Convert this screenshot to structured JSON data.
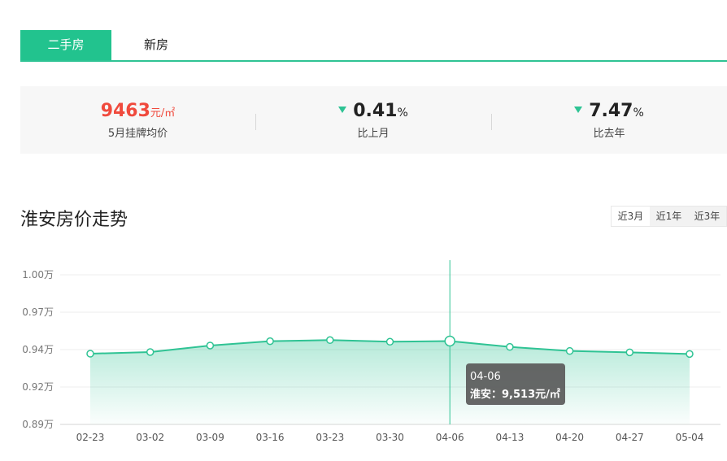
{
  "tabs": [
    {
      "label": "二手房",
      "active": true
    },
    {
      "label": "新房",
      "active": false
    }
  ],
  "stats": {
    "price": {
      "value": "9463",
      "unit": "元/㎡",
      "label": "5月挂牌均价"
    },
    "mom": {
      "value": "0.41",
      "unit": "%",
      "label": "比上月",
      "direction": "down"
    },
    "yoy": {
      "value": "7.47",
      "unit": "%",
      "label": "比去年",
      "direction": "down"
    }
  },
  "section_title": "淮安房价走势",
  "range_buttons": [
    {
      "label": "近3月",
      "active": true
    },
    {
      "label": "近1年",
      "active": false
    },
    {
      "label": "近3年",
      "active": false
    }
  ],
  "tooltip": {
    "date": "04-06",
    "text": "淮安：9,513元/㎡"
  },
  "colors": {
    "accent": "#22c38e",
    "line": "#2fc394",
    "price": "#f04a3d"
  },
  "chart_data": {
    "type": "area",
    "categories": [
      "02-23",
      "03-02",
      "03-09",
      "03-16",
      "03-23",
      "03-30",
      "04-06",
      "04-13",
      "04-20",
      "04-27",
      "05-04"
    ],
    "series": [
      {
        "name": "淮安",
        "values": [
          9420,
          9432,
          9480,
          9512,
          9520,
          9508,
          9513,
          9470,
          9440,
          9430,
          9418
        ]
      }
    ],
    "yticks": [
      "1.00万",
      "0.97万",
      "0.94万",
      "0.92万",
      "0.89万"
    ],
    "ylim": [
      8900,
      10000
    ],
    "highlight_index": 6,
    "grid": true
  }
}
